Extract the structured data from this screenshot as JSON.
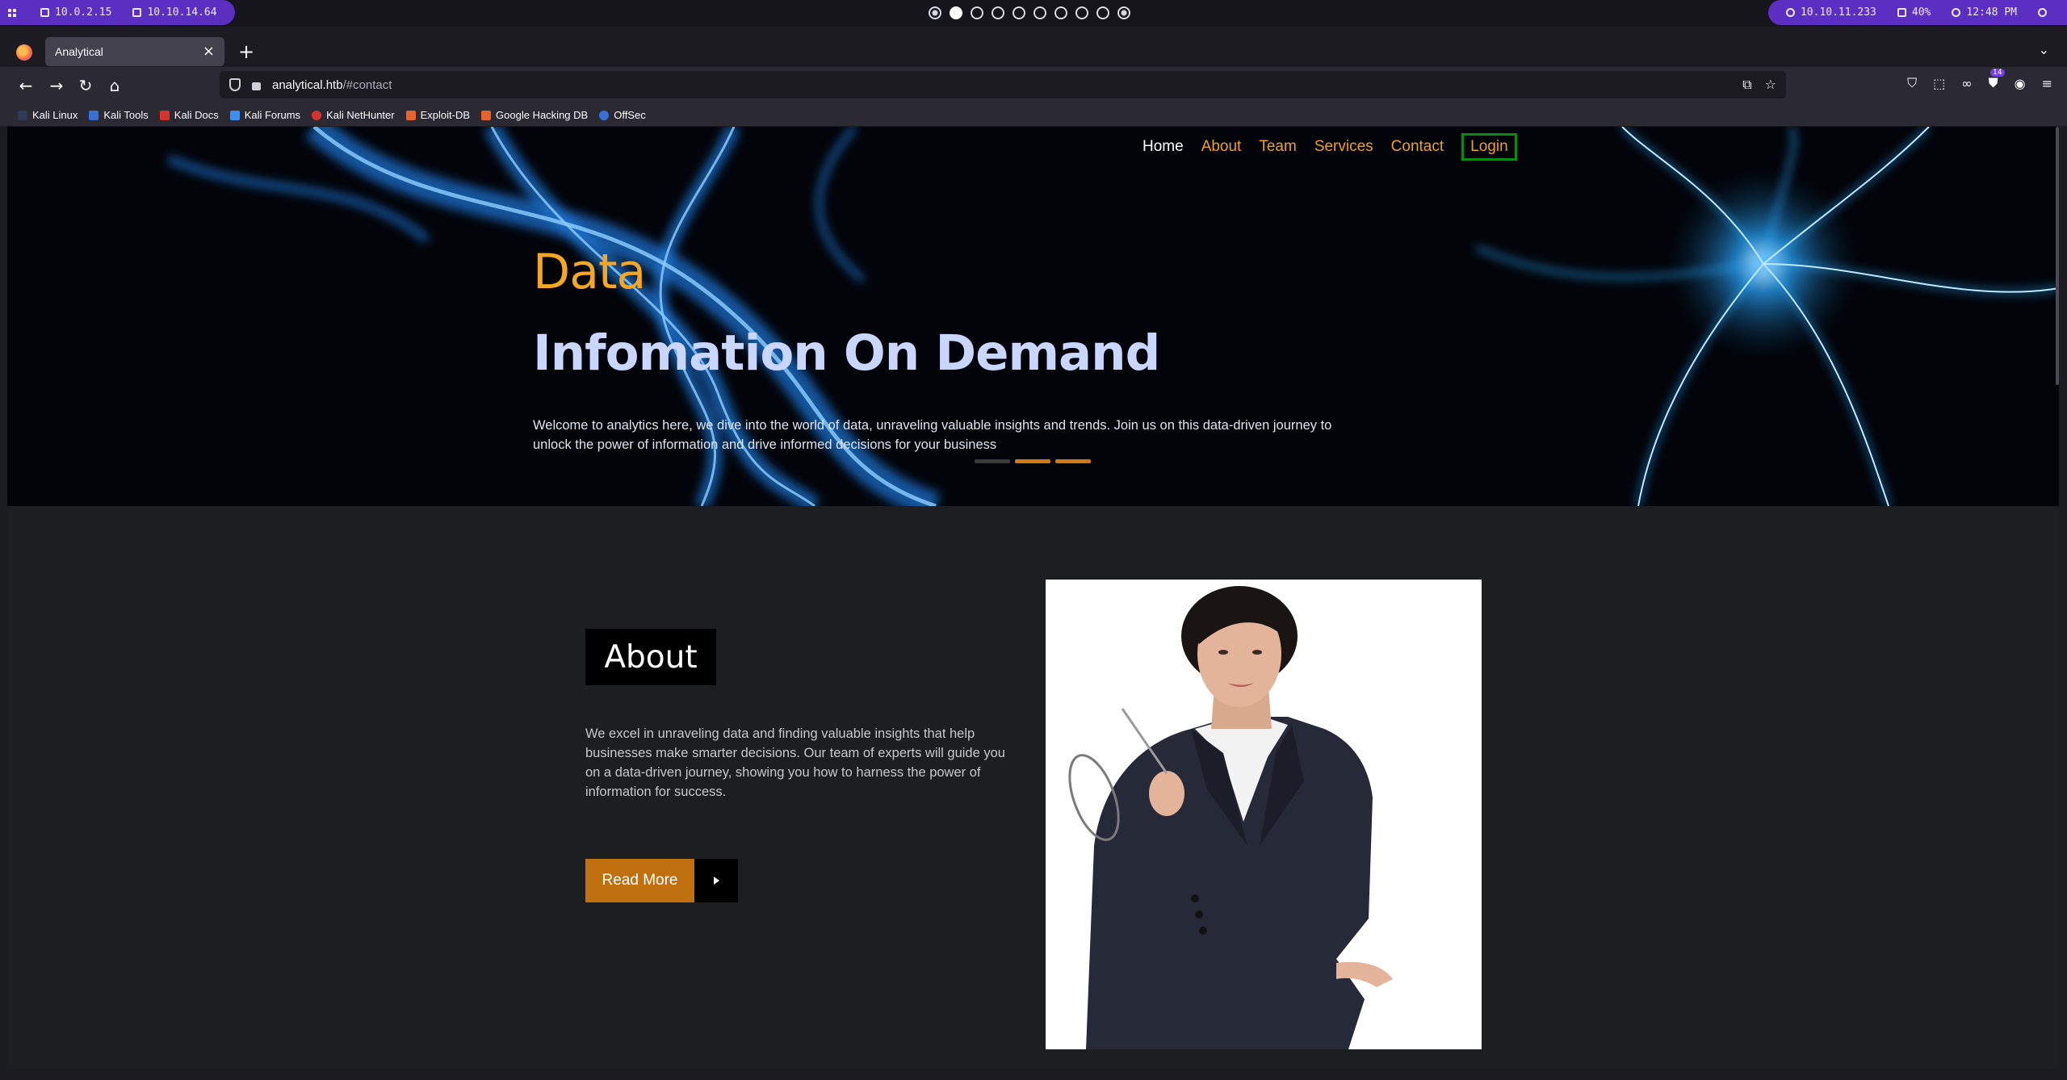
{
  "system_bar": {
    "ip_local": "10.0.2.15",
    "ip_vpn": "10.10.14.64",
    "target_ip": "10.10.11.233",
    "volume": "40%",
    "clock": "12:48 PM"
  },
  "browser": {
    "tab_title": "Analytical",
    "url_host": "analytical.htb",
    "url_path": "/#contact",
    "bookmarks": [
      "Kali Linux",
      "Kali Tools",
      "Kali Docs",
      "Kali Forums",
      "Kali NetHunter",
      "Exploit-DB",
      "Google Hacking DB",
      "OffSec"
    ],
    "extension_badge": "14"
  },
  "site": {
    "nav": [
      "Home",
      "About",
      "Team",
      "Services",
      "Contact",
      "Login"
    ],
    "hero_subtitle": "Data",
    "hero_title": "Infomation On Demand",
    "hero_text": "Welcome to analytics here, we dive into the world of data, unraveling valuable insights and trends. Join us on this data-driven journey to unlock the power of information and drive informed decisions for your business",
    "about_heading": "About",
    "about_text": "We excel in unraveling data and finding valuable insights that help businesses make smarter decisions. Our team of experts will guide you on a data-driven journey, showing you how to harness the power of information for success.",
    "read_more": "Read More"
  },
  "colors": {
    "accent": "#f5a623",
    "button": "#c1700f",
    "login_border": "#0a8a12",
    "system_purple": "#5b2fc2"
  }
}
